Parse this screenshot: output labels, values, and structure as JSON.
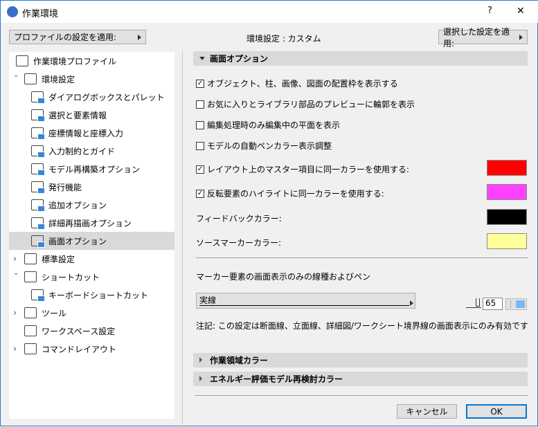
{
  "window": {
    "title": "作業環境",
    "help": "?",
    "close": "✕"
  },
  "toolbar": {
    "apply_profile": "プロファイルの設定を適用:",
    "env_label": "環境設定 : カスタム",
    "apply_selected": "選択した設定を適用:"
  },
  "tree": [
    {
      "label": "作業環境プロファイル",
      "level": 0,
      "icon": "monitor-gear-icon"
    },
    {
      "label": "環境設定",
      "level": 0,
      "expanded": true,
      "icon": "user-settings-icon"
    },
    {
      "label": "ダイアログボックスとパレット",
      "level": 1,
      "icon": "dialog-icon"
    },
    {
      "label": "選択と要素情報",
      "level": 1,
      "icon": "selection-icon"
    },
    {
      "label": "座標情報と座標入力",
      "level": 1,
      "icon": "xyz-icon"
    },
    {
      "label": "入力制約とガイド",
      "level": 1,
      "icon": "mouse-icon"
    },
    {
      "label": "モデル再構築オプション",
      "level": 1,
      "icon": "bricks-icon"
    },
    {
      "label": "発行機能",
      "level": 1,
      "icon": "publish-icon"
    },
    {
      "label": "追加オプション",
      "level": 1,
      "icon": "sliders-icon"
    },
    {
      "label": "詳細再描画オプション",
      "level": 1,
      "icon": "redraw-icon"
    },
    {
      "label": "画面オプション",
      "level": 1,
      "selected": true,
      "icon": "screen-icon"
    },
    {
      "label": "標準設定",
      "level": 0,
      "collapsed": true,
      "icon": "defaults-icon"
    },
    {
      "label": "ショートカット",
      "level": 0,
      "expanded": true,
      "icon": "shortcut-icon"
    },
    {
      "label": "キーボードショートカット",
      "level": 1,
      "icon": "keyboard-shortcut-icon"
    },
    {
      "label": "ツール",
      "level": 0,
      "collapsed": true,
      "icon": "tool-icon"
    },
    {
      "label": "ワークスペース設定",
      "level": 0,
      "icon": "workspace-icon"
    },
    {
      "label": "コマンドレイアウト",
      "level": 0,
      "collapsed": true,
      "icon": "command-layout-icon"
    }
  ],
  "screen_options": {
    "header": "画面オプション",
    "checks": [
      {
        "label": "オブジェクト、柱、画像、図面の配置枠を表示する",
        "checked": true
      },
      {
        "label": "お気に入りとライブラリ部品のプレビューに輪郭を表示",
        "checked": false
      },
      {
        "label": "編集処理時のみ編集中の平面を表示",
        "checked": false
      },
      {
        "label": "モデルの自動ペンカラー表示調整",
        "checked": false
      },
      {
        "label": "レイアウト上のマスター項目に同一カラーを使用する:",
        "checked": true,
        "color": "#ff0000"
      },
      {
        "label": "反転要素のハイライトに同一カラーを使用する:",
        "checked": true,
        "color": "#ff40ff"
      }
    ],
    "feedback_label": "フィードバックカラー:",
    "feedback_color": "#000000",
    "source_label": "ソースマーカーカラー:",
    "source_color": "#ffff99",
    "marker_label": "マーカー要素の画面表示のみの線種およびペン",
    "line_type": "実線",
    "pen": "65",
    "note": "注記: この設定は断面線、立面線、詳細図/ワークシート境界線の画面表示にのみ有効です"
  },
  "sections": {
    "workspace_color": "作業領域カラー",
    "energy_color": "エネルギー評価モデル再検討カラー"
  },
  "buttons": {
    "cancel": "キャンセル",
    "ok": "OK"
  }
}
